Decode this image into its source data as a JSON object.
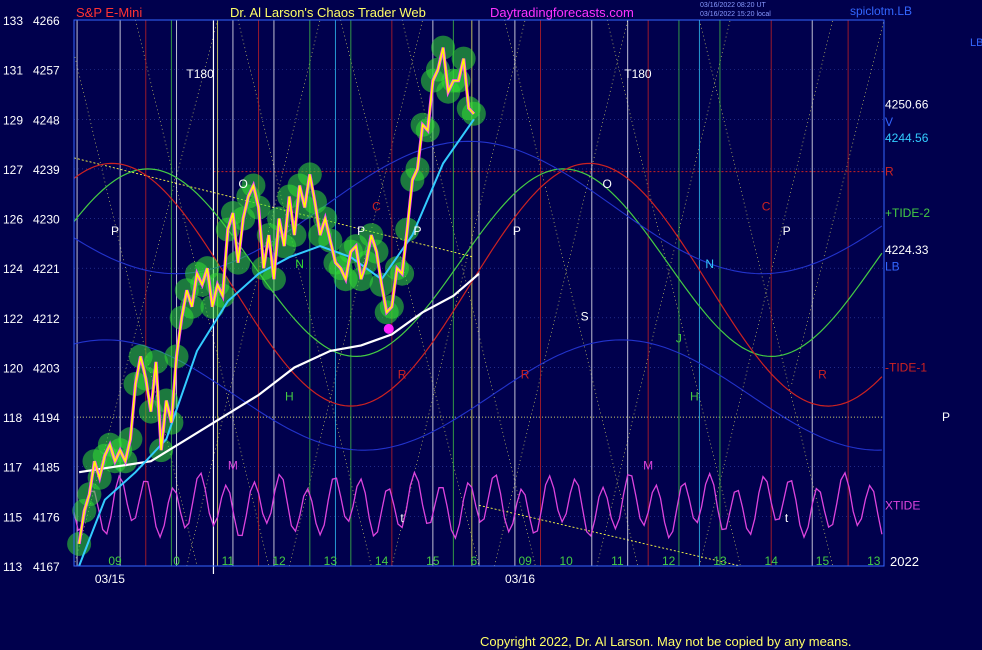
{
  "header": {
    "symbol": "S&P E-Mini",
    "title": "Dr. Al Larson's Chaos Trader Web",
    "site": "Daytradingforecasts.com",
    "timestamp_line1": "03/16/2022 08:20 UT",
    "timestamp_line2": "03/16/2022 15:20 local",
    "corner_text": "spiclotm.LB",
    "corner_right": "LB"
  },
  "footer": {
    "copyright": "Copyright 2022, Dr. Al Larson. May not be copied by any means.",
    "year": "2022"
  },
  "colors": {
    "background": "#00004d",
    "plot_border": "#3366ff",
    "price_line": "#ffff00",
    "fast_avg": "#33ccff",
    "slow_avg": "#ffffff",
    "electric_field": "#33dd33",
    "tide_plus": "#44cc44",
    "tide_minus": "#cc2222",
    "xtide": "#dd44dd",
    "yaxis_text": "#ffffff",
    "title_red": "#ff3333",
    "title_yellow": "#ffff66",
    "site_magenta": "#ff33ff"
  },
  "chart_data": {
    "type": "line",
    "y_axis_pairs": [
      {
        "left": "133",
        "price": "4266"
      },
      {
        "left": "131",
        "price": "4257"
      },
      {
        "left": "129",
        "price": "4248"
      },
      {
        "left": "127",
        "price": "4239"
      },
      {
        "left": "126",
        "price": "4230"
      },
      {
        "left": "124",
        "price": "4221"
      },
      {
        "left": "122",
        "price": "4212"
      },
      {
        "left": "120",
        "price": "4203"
      },
      {
        "left": "118",
        "price": "4194"
      },
      {
        "left": "117",
        "price": "4185"
      },
      {
        "left": "115",
        "price": "4176"
      },
      {
        "left": "113",
        "price": "4167"
      }
    ],
    "ylim": [
      4167,
      4266
    ],
    "xlim": [
      8.0,
      15.9
    ],
    "day_break_x": 9.36,
    "x_ticks": [
      {
        "label": "09",
        "x": 8.4
      },
      {
        "label": "0",
        "x": 9.0
      },
      {
        "label": "11",
        "x": 9.5
      },
      {
        "label": "12",
        "x": 10.0
      },
      {
        "label": "13",
        "x": 10.5
      },
      {
        "label": "14",
        "x": 11.0
      },
      {
        "label": "15",
        "x": 11.5
      },
      {
        "label": "6",
        "x": 11.9
      },
      {
        "label": "09",
        "x": 12.4
      },
      {
        "label": "10",
        "x": 12.8
      },
      {
        "label": "11",
        "x": 13.3
      },
      {
        "label": "12",
        "x": 13.8
      },
      {
        "label": "13",
        "x": 14.3
      },
      {
        "label": "14",
        "x": 14.8
      },
      {
        "label": "15",
        "x": 15.3
      },
      {
        "label": "13",
        "x": 15.8
      }
    ],
    "date_labels": [
      {
        "label": "03/15",
        "x": 8.35
      },
      {
        "label": "03/16",
        "x": 12.35
      }
    ],
    "price_series": {
      "x": [
        8.05,
        8.1,
        8.15,
        8.2,
        8.25,
        8.3,
        8.35,
        8.4,
        8.45,
        8.5,
        8.55,
        8.6,
        8.65,
        8.7,
        8.75,
        8.8,
        8.85,
        8.9,
        8.95,
        9.0,
        9.05,
        9.1,
        9.15,
        9.2,
        9.25,
        9.3,
        9.35,
        9.4,
        9.45,
        9.5,
        9.55,
        9.6,
        9.65,
        9.7,
        9.75,
        9.8,
        9.85,
        9.9,
        9.95,
        10.0,
        10.05,
        10.1,
        10.15,
        10.2,
        10.25,
        10.3,
        10.35,
        10.4,
        10.45,
        10.5,
        10.55,
        10.6,
        10.65,
        10.7,
        10.75,
        10.8,
        10.85,
        10.9,
        10.95,
        11.0,
        11.05,
        11.1,
        11.15,
        11.2,
        11.25,
        11.3,
        11.35,
        11.4,
        11.45,
        11.5,
        11.55,
        11.6,
        11.65,
        11.7,
        11.75,
        11.8,
        11.85,
        11.9
      ],
      "y": [
        4171,
        4177,
        4180,
        4186,
        4183,
        4187,
        4189,
        4186,
        4188,
        4186,
        4190,
        4200,
        4205,
        4201,
        4195,
        4204,
        4188,
        4197,
        4193,
        4205,
        4212,
        4217,
        4214,
        4220,
        4218,
        4221,
        4214,
        4218,
        4216,
        4228,
        4231,
        4222,
        4230,
        4234,
        4236,
        4232,
        4221,
        4227,
        4219,
        4230,
        4225,
        4234,
        4227,
        4236,
        4232,
        4238,
        4233,
        4227,
        4230,
        4226,
        4222,
        4221,
        4219,
        4224,
        4225,
        4219,
        4222,
        4227,
        4224,
        4218,
        4213,
        4214,
        4221,
        4220,
        4228,
        4237,
        4239,
        4247,
        4246,
        4255,
        4257,
        4261,
        4253,
        4255,
        4255,
        4259,
        4250,
        4249
      ]
    },
    "fast_average": {
      "x": [
        8.05,
        8.3,
        8.6,
        8.9,
        9.2,
        9.5,
        9.8,
        10.1,
        10.4,
        10.7,
        11.0,
        11.3,
        11.6,
        11.9
      ],
      "y": [
        4167,
        4179,
        4184,
        4190,
        4206,
        4215,
        4220,
        4223,
        4225,
        4223,
        4219,
        4227,
        4240,
        4248
      ]
    },
    "slow_average": {
      "x": [
        8.05,
        8.4,
        8.75,
        9.1,
        9.45,
        9.8,
        10.15,
        10.5,
        10.8,
        11.1,
        11.4,
        11.7,
        11.95
      ],
      "y": [
        4184,
        4185,
        4186,
        4190,
        4194,
        4198,
        4203,
        4206,
        4207,
        4209,
        4213,
        4216,
        4220
      ]
    },
    "xtide_y": 4178,
    "electric_field_y": 4228,
    "tide_band_y": 4222,
    "right_labels": [
      {
        "text": "4250.66",
        "y": 4250.7,
        "color": "#ffffff"
      },
      {
        "text": "V",
        "y": 4247.5,
        "color": "#3366ff"
      },
      {
        "text": "4244.56",
        "y": 4244.6,
        "color": "#33ccff"
      },
      {
        "text": "R",
        "y": 4238.5,
        "color": "#cc2222"
      },
      {
        "text": "+TIDE-2",
        "y": 4231,
        "color": "#44cc44"
      },
      {
        "text": "4224.33",
        "y": 4224.3,
        "color": "#ffffff"
      },
      {
        "text": "LB",
        "y": 4221.3,
        "color": "#3366ff"
      },
      {
        "text": "-TIDE-1",
        "y": 4203,
        "color": "#cc2222"
      },
      {
        "text": "P",
        "y": 4194,
        "color": "#ffffff"
      },
      {
        "text": "XTIDE",
        "y": 4178,
        "color": "#dd44dd"
      }
    ],
    "chart_letters": [
      {
        "text": "T180",
        "x": 9.23,
        "y": 4255.5,
        "color": "#ffffff"
      },
      {
        "text": "T180",
        "x": 13.5,
        "y": 4255.5,
        "color": "#ffffff"
      },
      {
        "text": "O",
        "x": 9.65,
        "y": 4235.5,
        "color": "#ffffff"
      },
      {
        "text": "O",
        "x": 13.2,
        "y": 4235.5,
        "color": "#ffffff"
      },
      {
        "text": "P",
        "x": 8.4,
        "y": 4227,
        "color": "#ffffff"
      },
      {
        "text": "P",
        "x": 10.8,
        "y": 4227,
        "color": "#ffffff"
      },
      {
        "text": "P",
        "x": 11.35,
        "y": 4227,
        "color": "#ffffff"
      },
      {
        "text": "P",
        "x": 12.32,
        "y": 4227,
        "color": "#ffffff"
      },
      {
        "text": "P",
        "x": 14.95,
        "y": 4227,
        "color": "#ffffff"
      },
      {
        "text": "N",
        "x": 10.2,
        "y": 4221,
        "color": "#33dd33"
      },
      {
        "text": "N",
        "x": 14.2,
        "y": 4221,
        "color": "#33ccff"
      },
      {
        "text": "M",
        "x": 9.55,
        "y": 4184.5,
        "color": "#dd44dd"
      },
      {
        "text": "M",
        "x": 13.6,
        "y": 4184.5,
        "color": "#dd44dd"
      },
      {
        "text": "H",
        "x": 10.1,
        "y": 4197,
        "color": "#44cc44"
      },
      {
        "text": "H",
        "x": 14.05,
        "y": 4197,
        "color": "#44cc44"
      },
      {
        "text": "J",
        "x": 13.9,
        "y": 4207.5,
        "color": "#44cc44"
      },
      {
        "text": "S",
        "x": 12.98,
        "y": 4211.5,
        "color": "#ffffff"
      },
      {
        "text": "R",
        "x": 11.2,
        "y": 4201,
        "color": "#cc2222"
      },
      {
        "text": "R",
        "x": 12.4,
        "y": 4201,
        "color": "#cc2222"
      },
      {
        "text": "R",
        "x": 15.3,
        "y": 4201,
        "color": "#cc2222"
      },
      {
        "text": "C",
        "x": 10.95,
        "y": 4231.5,
        "color": "#cc2222"
      },
      {
        "text": "C",
        "x": 14.75,
        "y": 4231.5,
        "color": "#cc2222"
      },
      {
        "text": "t",
        "x": 11.2,
        "y": 4175,
        "color": "#ffffff"
      },
      {
        "text": "t",
        "x": 14.95,
        "y": 4175,
        "color": "#ffffff"
      }
    ],
    "vertical_lines": [
      {
        "x": 8.03,
        "color": "#ffffff"
      },
      {
        "x": 8.45,
        "color": "#ffffff"
      },
      {
        "x": 8.7,
        "color": "#cc2222"
      },
      {
        "x": 8.95,
        "color": "#44cc44"
      },
      {
        "x": 9.0,
        "color": "#ffffff"
      },
      {
        "x": 9.4,
        "color": "#ffff66"
      },
      {
        "x": 9.55,
        "color": "#ffffff"
      },
      {
        "x": 9.8,
        "color": "#cc2222"
      },
      {
        "x": 9.95,
        "color": "#ffffff"
      },
      {
        "x": 10.3,
        "color": "#44cc44"
      },
      {
        "x": 10.55,
        "color": "#33ccff"
      },
      {
        "x": 10.7,
        "color": "#44cc44"
      },
      {
        "x": 11.1,
        "color": "#cc2222"
      },
      {
        "x": 11.5,
        "color": "#ffffff"
      },
      {
        "x": 11.7,
        "color": "#44cc44"
      },
      {
        "x": 11.88,
        "color": "#ffff66"
      },
      {
        "x": 11.95,
        "color": "#ffffff"
      },
      {
        "x": 12.3,
        "color": "#ffffff"
      },
      {
        "x": 12.55,
        "color": "#cc2222"
      },
      {
        "x": 13.05,
        "color": "#ffffff"
      },
      {
        "x": 13.4,
        "color": "#ffffff"
      },
      {
        "x": 13.6,
        "color": "#cc2222"
      },
      {
        "x": 13.9,
        "color": "#44cc44"
      },
      {
        "x": 14.1,
        "color": "#33ccff"
      },
      {
        "x": 14.3,
        "color": "#44cc44"
      },
      {
        "x": 14.8,
        "color": "#cc2222"
      },
      {
        "x": 15.2,
        "color": "#ffffff"
      },
      {
        "x": 15.55,
        "color": "#cc2222"
      }
    ]
  }
}
